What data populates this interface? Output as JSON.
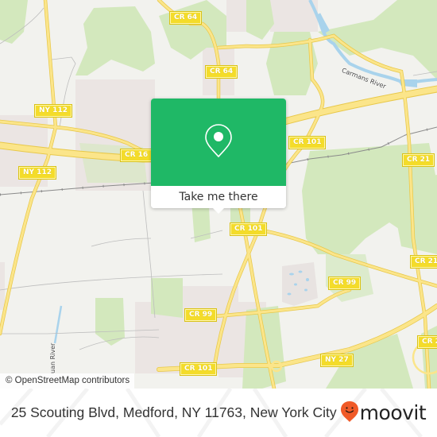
{
  "map": {
    "road_labels": [
      {
        "id": "cr64-top",
        "text": "CR 64"
      },
      {
        "id": "cr64-mid",
        "text": "CR 64"
      },
      {
        "id": "ny112-top",
        "text": "NY 112"
      },
      {
        "id": "ny112-bottom",
        "text": "NY 112"
      },
      {
        "id": "cr16",
        "text": "CR 16"
      },
      {
        "id": "cr101-top",
        "text": "CR 101"
      },
      {
        "id": "cr21-top",
        "text": "CR 21"
      },
      {
        "id": "cr101-mid",
        "text": "CR 101"
      },
      {
        "id": "cr21-mid",
        "text": "CR 21"
      },
      {
        "id": "cr99-right",
        "text": "CR 99"
      },
      {
        "id": "cr99-left",
        "text": "CR 99"
      },
      {
        "id": "cr101-bottom",
        "text": "CR 101"
      },
      {
        "id": "ny27",
        "text": "NY 27"
      },
      {
        "id": "cr21-bottom",
        "text": "CR 2"
      }
    ],
    "water_labels": {
      "carmans_river": "Carmans River",
      "west_river": "uan River"
    },
    "attribution": "© OpenStreetMap contributors"
  },
  "popup": {
    "icon": "map-pin-icon",
    "button_label": "Take me there",
    "color": "#1fb866"
  },
  "footer": {
    "address": "25 Scouting Blvd, Medford, NY 11763, New York City",
    "brand": "moovit",
    "brand_icon": "moovit-pin-smile-icon",
    "brand_color": "#f05a28"
  }
}
